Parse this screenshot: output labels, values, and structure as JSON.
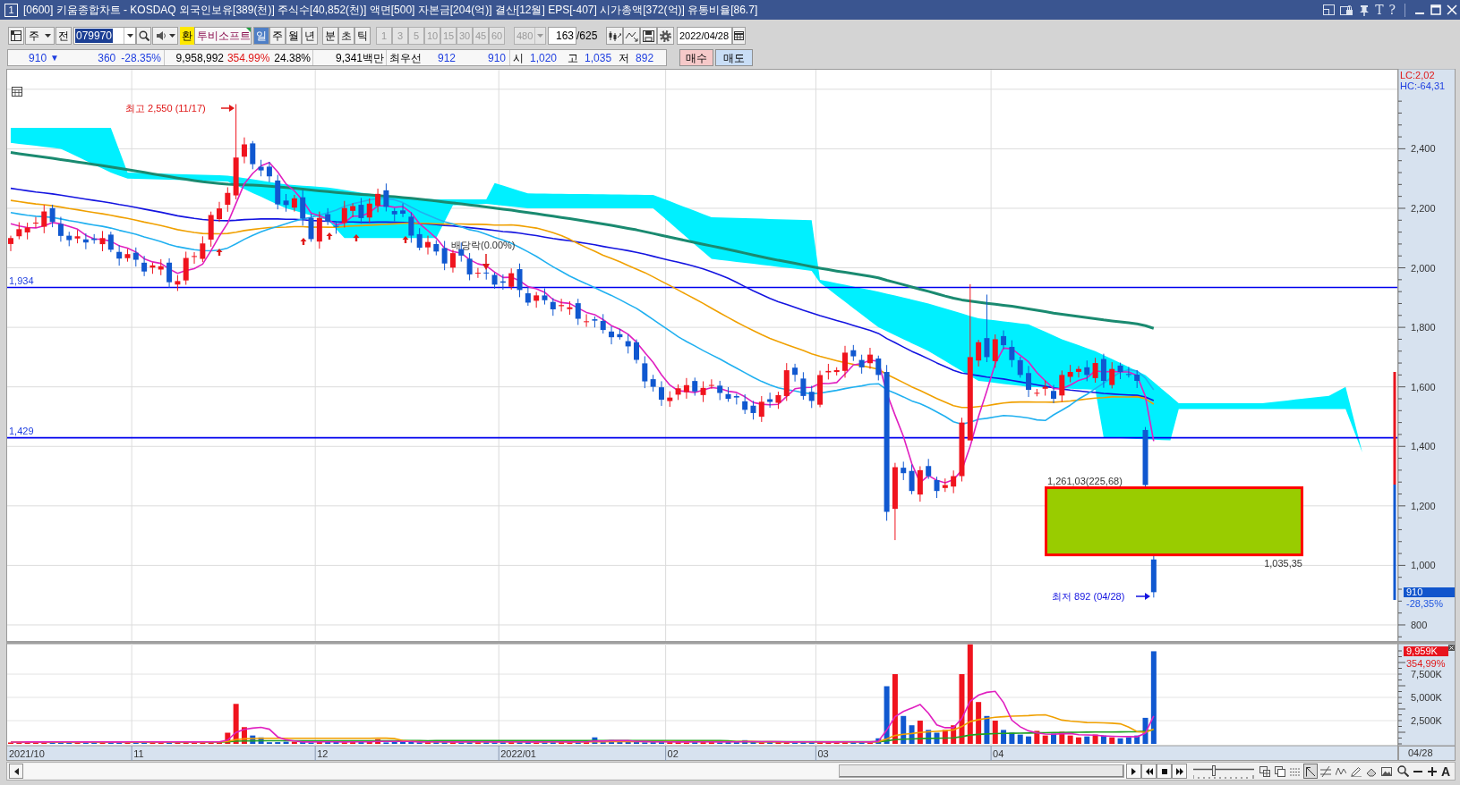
{
  "window": {
    "badge": "1",
    "title": "[0600] 키움종합차트 - KOSDAQ 외국인보유[389(천)] 주식수[40,852(천)] 액면[500] 자본금[204(억)] 결산[12월] EPS[-407] 시가총액[372(억)] 유통비율[86.7]",
    "tool_glyphs": [
      "T",
      "?"
    ]
  },
  "toolbar": {
    "market": "주",
    "prev_button": "전",
    "code": "079970",
    "currency_badge": "환",
    "stock_name": "투비소프트",
    "periods": [
      {
        "label": "일",
        "selected": true
      },
      {
        "label": "주",
        "selected": false
      },
      {
        "label": "월",
        "selected": false
      },
      {
        "label": "년",
        "selected": false
      }
    ],
    "time_units": [
      {
        "label": "분",
        "selected": false
      },
      {
        "label": "초",
        "selected": false
      },
      {
        "label": "틱",
        "selected": false
      }
    ],
    "intervals": [
      {
        "label": "1",
        "disabled": true
      },
      {
        "label": "3",
        "disabled": true
      },
      {
        "label": "5",
        "disabled": true
      },
      {
        "label": "10",
        "disabled": true
      },
      {
        "label": "15",
        "disabled": true
      },
      {
        "label": "30",
        "disabled": true
      },
      {
        "label": "45",
        "disabled": true
      },
      {
        "label": "60",
        "disabled": true
      }
    ],
    "custom_interval": {
      "label": "480",
      "disabled": true
    },
    "bar_count": "163",
    "bar_total": "/625",
    "date": "2022/04/28"
  },
  "quote": {
    "price": "910",
    "trend_glyph": "▼",
    "change": "360",
    "change_rate": "-28.35%",
    "volume": "9,958,992",
    "volume_ratio": "354.99%",
    "turnover": "24.38%",
    "trade_value": "9,341백만",
    "best_label": "최우선",
    "best_ask": "912",
    "best_bid": "910",
    "ohl": [
      {
        "label": "시",
        "value": "1,020"
      },
      {
        "label": "고",
        "value": "1,035"
      },
      {
        "label": "저",
        "value": "892"
      }
    ],
    "buttons": [
      {
        "label": "매수",
        "kind": "buy"
      },
      {
        "label": "매도",
        "kind": "sell"
      }
    ]
  },
  "price_chart": {
    "lc_label": "LC:2,02",
    "hc_label": "HC:-64,31",
    "y_ticks": [
      "2,400",
      "2,200",
      "2,000",
      "1,800",
      "1,600",
      "1,400",
      "1,200",
      "1,000",
      "800"
    ],
    "level_lines": [
      "1,934",
      "1,429"
    ],
    "high_note": "최고 2,550 (11/17)",
    "event_note": "배당락(0.00%)",
    "low_note": "최저 892 (04/28)",
    "box": {
      "top_label": "1,261,03(225,68)",
      "bottom_label": "1,035,35"
    },
    "last_price": "910",
    "last_change": "-28,35%"
  },
  "volume_chart": {
    "last_volume": "9,959K",
    "last_ratio": "354,99%",
    "y_ticks": [
      "7,500K",
      "5,000K",
      "2,500K"
    ]
  },
  "time_axis": {
    "labels": [
      "2021/10",
      "11",
      "12",
      "2022/01",
      "02",
      "03",
      "04"
    ],
    "current": "04/28"
  },
  "bottom_bar": {
    "zoom_slider": {
      "level": 0.33
    },
    "tools": [
      {
        "selected": false
      },
      {
        "selected": false
      },
      {
        "selected": false
      },
      {
        "selected": true
      },
      {
        "selected": false
      },
      {
        "selected": false
      },
      {
        "selected": false
      },
      {
        "selected": false
      },
      {
        "selected": false
      }
    ],
    "font_glyph": "A"
  }
}
